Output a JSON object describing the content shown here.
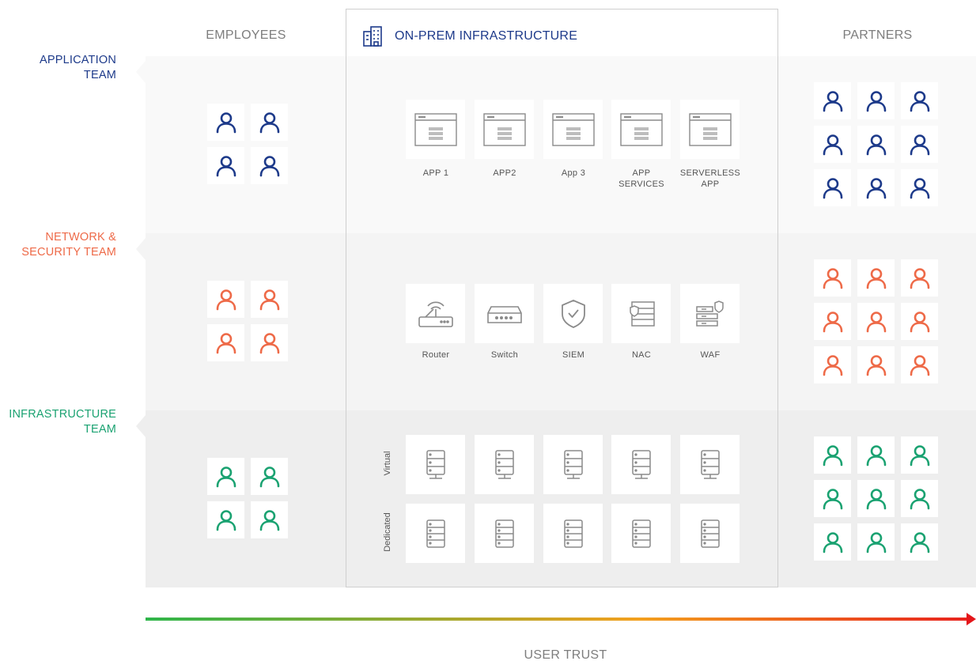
{
  "columns": {
    "employees": "EMPLOYEES",
    "onprem": "ON-PREM INFRASTRUCTURE",
    "partners": "PARTNERS"
  },
  "rows": {
    "application": {
      "line1": "APPLICATION",
      "line2": "TEAM",
      "color": "#1d3a8a"
    },
    "network": {
      "line1": "NETWORK &",
      "line2": "SECURITY TEAM",
      "color": "#ee6a48"
    },
    "infrastructure": {
      "line1": "INFRASTRUCTURE",
      "line2": "TEAM",
      "color": "#1aa271"
    }
  },
  "apps": [
    {
      "label1": "APP 1",
      "label2": ""
    },
    {
      "label1": "APP2",
      "label2": ""
    },
    {
      "label1": "App 3",
      "label2": ""
    },
    {
      "label1": "APP",
      "label2": "SERVICES"
    },
    {
      "label1": "SERVERLESS",
      "label2": "APP"
    }
  ],
  "network_devices": [
    {
      "label": "Router",
      "icon": "router-icon"
    },
    {
      "label": "Switch",
      "icon": "switch-icon"
    },
    {
      "label": "SIEM",
      "icon": "shield-icon"
    },
    {
      "label": "NAC",
      "icon": "nac-icon"
    },
    {
      "label": "WAF",
      "icon": "waf-icon"
    }
  ],
  "servers": {
    "virtual_label": "Virtual",
    "dedicated_label": "Dedicated"
  },
  "axis": {
    "label": "USER TRUST"
  }
}
